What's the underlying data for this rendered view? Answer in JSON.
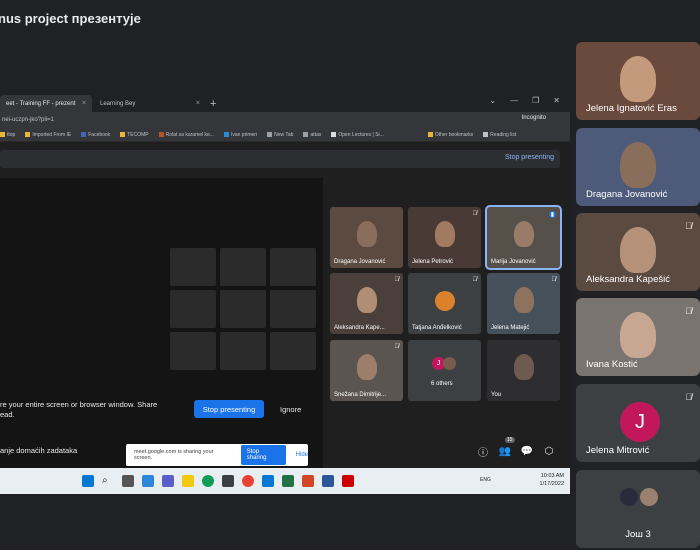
{
  "window": {
    "title": "nus project презентује"
  },
  "browser": {
    "tabs": [
      {
        "label": "eet - Training FF - prezent",
        "active": true
      },
      {
        "label": "Learning Bey",
        "active": false
      }
    ],
    "address": "nei-uczpn-jko?pli=1",
    "incognito_label": "Incognito",
    "bookmarks": [
      "ttop",
      "Imported From IE",
      "Facebook",
      "TECOMP",
      "Rolat sa karamel ke...",
      "Ivan primeri",
      "New Tab",
      "attas",
      "Open Lectures | Si...",
      "Other bookmarks",
      "Reading list"
    ]
  },
  "presenting_bar": {
    "stop_label": "Stop presenting"
  },
  "share_prompt": {
    "message": "re your entire screen or browser window. Share ead.",
    "stop_label": "Stop presenting",
    "ignore_label": "Ignore"
  },
  "meeting": {
    "name": "anje domaćih zadataka",
    "participants_count": "15"
  },
  "share_toast": {
    "message": "meet.google.com is sharing your screen.",
    "stop_label": "Stop sharing",
    "hide_label": "Hide"
  },
  "inner_grid": [
    {
      "name": "Dragana Jovanović",
      "mic_off": false
    },
    {
      "name": "Jelena Petrović",
      "mic_off": true
    },
    {
      "name": "Marija Jovanović",
      "mic_off": false,
      "highlight": true
    },
    {
      "name": "Aleksandra Kape...",
      "mic_off": true
    },
    {
      "name": "Tatjana Anđelković",
      "mic_off": true
    },
    {
      "name": "Jelena Matejić",
      "mic_off": true
    },
    {
      "name": "Snežana Dimitrije...",
      "mic_off": true
    },
    {
      "name": "6 others",
      "mic_off": false
    },
    {
      "name": "You",
      "mic_off": false
    }
  ],
  "taskbar": {
    "lang": "ENG",
    "time": "10:03 AM",
    "date": "1/17/2022"
  },
  "side_tiles": [
    {
      "name": "Jelena Ignatović Eras",
      "mic_off": false
    },
    {
      "name": "Dragana Jovanović",
      "mic_off": false
    },
    {
      "name": "Aleksandra Kapešić",
      "mic_off": true
    },
    {
      "name": "Ivana Kostić",
      "mic_off": true
    },
    {
      "name": "Jelena Mitrović",
      "mic_off": true,
      "initial": "J"
    },
    {
      "name": "Још 3",
      "mic_off": false
    }
  ],
  "colors": {
    "background": "#202124",
    "tile": "#3c4043",
    "accent": "#1a73e8",
    "avatar_j": "#c2185b"
  }
}
